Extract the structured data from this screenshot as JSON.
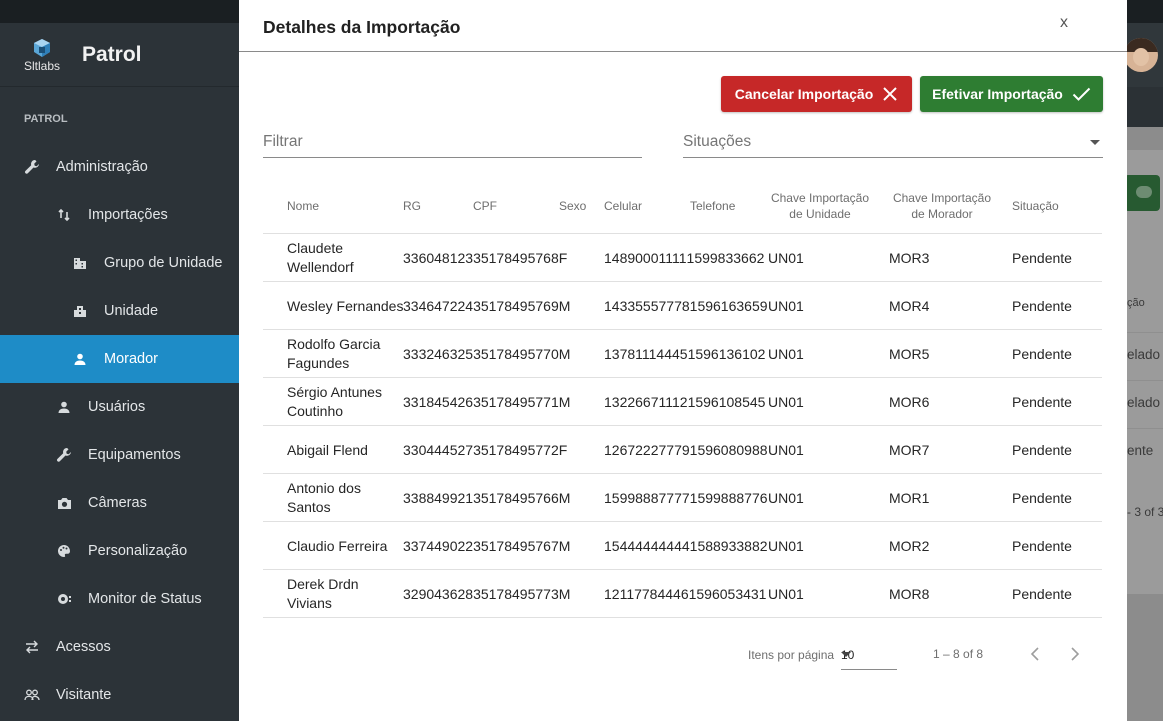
{
  "app": {
    "brand": "Patrol",
    "logo_text": "Sltlabs",
    "section_label": "PATROL"
  },
  "sidebar": {
    "items": [
      {
        "label": "Administração",
        "icon": "wrench-icon"
      },
      {
        "label": "Importações",
        "icon": "import-arrows-icon"
      },
      {
        "label": "Grupo de Unidade",
        "icon": "building-group-icon"
      },
      {
        "label": "Unidade",
        "icon": "building-icon"
      },
      {
        "label": "Morador",
        "icon": "person-icon"
      },
      {
        "label": "Usuários",
        "icon": "person-icon"
      },
      {
        "label": "Equipamentos",
        "icon": "wrench-icon"
      },
      {
        "label": "Câmeras",
        "icon": "camera-icon"
      },
      {
        "label": "Personalização",
        "icon": "palette-icon"
      },
      {
        "label": "Monitor de Status",
        "icon": "monitor-status-icon"
      },
      {
        "label": "Acessos",
        "icon": "swap-arrows-icon"
      },
      {
        "label": "Visitante",
        "icon": "people-icon"
      }
    ]
  },
  "background_peek": {
    "col_header": "ção",
    "row1": "elado",
    "row2": "elado",
    "row3": "ente",
    "paging": "- 3 of 3"
  },
  "dialog": {
    "title": "Detalhes da Importação",
    "close_label": "x",
    "cancel_label": "Cancelar Importação",
    "confirm_label": "Efetivar Importação",
    "filter_placeholder": "Filtrar",
    "status_label": "Situações",
    "columns": {
      "nome": "Nome",
      "rg": "RG",
      "cpf": "CPF",
      "sexo": "Sexo",
      "celular": "Celular",
      "telefone": "Telefone",
      "chave_unidade_1": "Chave Importação",
      "chave_unidade_2": "de Unidade",
      "chave_morador_1": "Chave Importação",
      "chave_morador_2": "de Morador",
      "situacao": "Situação"
    },
    "rows": [
      {
        "nome": "Claudete Wellendorf",
        "rg": "336048123",
        "cpf": "35178495768",
        "sexo": "F",
        "celular": "14890001111",
        "telefone": "1599833662",
        "chave_unidade": "UN01",
        "chave_morador": "MOR3",
        "situacao": "Pendente"
      },
      {
        "nome": "Wesley Fernandes",
        "rg": "334647224",
        "cpf": "35178495769",
        "sexo": "M",
        "celular": "14335557778",
        "telefone": "1596163659",
        "chave_unidade": "UN01",
        "chave_morador": "MOR4",
        "situacao": "Pendente"
      },
      {
        "nome": "Rodolfo Garcia Fagundes",
        "rg": "333246325",
        "cpf": "35178495770",
        "sexo": "M",
        "celular": "13781114445",
        "telefone": "1596136102",
        "chave_unidade": "UN01",
        "chave_morador": "MOR5",
        "situacao": "Pendente"
      },
      {
        "nome": "Sérgio Antunes Coutinho",
        "rg": "331845426",
        "cpf": "35178495771",
        "sexo": "M",
        "celular": "13226671112",
        "telefone": "1596108545",
        "chave_unidade": "UN01",
        "chave_morador": "MOR6",
        "situacao": "Pendente"
      },
      {
        "nome": "Abigail Flend",
        "rg": "330444527",
        "cpf": "35178495772",
        "sexo": "F",
        "celular": "12672227779",
        "telefone": "1596080988",
        "chave_unidade": "UN01",
        "chave_morador": "MOR7",
        "situacao": "Pendente"
      },
      {
        "nome": "Antonio dos Santos",
        "rg": "338849921",
        "cpf": "35178495766",
        "sexo": "M",
        "celular": "15998887777",
        "telefone": "1599888776",
        "chave_unidade": "UN01",
        "chave_morador": "MOR1",
        "situacao": "Pendente"
      },
      {
        "nome": "Claudio Ferreira",
        "rg": "337449022",
        "cpf": "35178495767",
        "sexo": "M",
        "celular": "15444444444",
        "telefone": "1588933882",
        "chave_unidade": "UN01",
        "chave_morador": "MOR2",
        "situacao": "Pendente"
      },
      {
        "nome": "Derek Drdn Vivians",
        "rg": "329043628",
        "cpf": "35178495773",
        "sexo": "M",
        "celular": "12117784446",
        "telefone": "1596053431",
        "chave_unidade": "UN01",
        "chave_morador": "MOR8",
        "situacao": "Pendente"
      }
    ],
    "paginator": {
      "items_label": "Itens por página",
      "page_size": "10",
      "range": "1 – 8 of 8"
    }
  },
  "colors": {
    "sidebar_bg": "#2c3338",
    "active_item": "#1e8cc7",
    "cancel": "#c62828",
    "confirm": "#2e7d32"
  }
}
